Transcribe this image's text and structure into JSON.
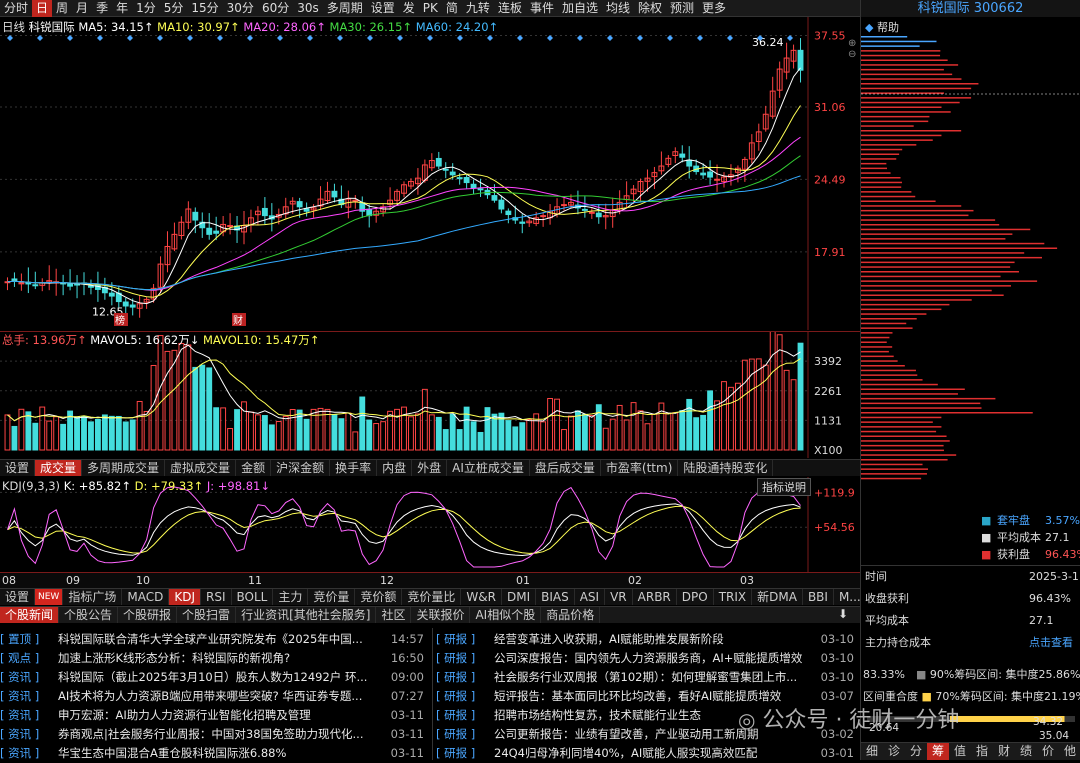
{
  "toolbar": {
    "items": [
      "分时",
      "日",
      "周",
      "月",
      "季",
      "年",
      "1分",
      "5分",
      "15分",
      "30分",
      "60分",
      "30s",
      "多周期",
      "设置",
      "发",
      "PK",
      "简",
      "九转",
      "连板",
      "事件",
      "加自选",
      "均线",
      "除权",
      "预测",
      "更多"
    ],
    "active": "日"
  },
  "kline": {
    "period_label": "日线",
    "stock_name": "科锐国际",
    "ma5": "MA5: 34.15↑",
    "ma10": "MA10: 30.97↑",
    "ma20": "MA20: 28.06↑",
    "ma30": "MA30: 26.15↑",
    "ma60": "MA60: 24.20↑",
    "price_axis": [
      "37.55",
      "31.06",
      "24.49",
      "17.91"
    ],
    "high_label": "36.24",
    "low_label": "12.65",
    "marks": [
      "榜",
      "财"
    ],
    "colors": {
      "ma5": "#ffffff",
      "ma10": "#ffff55",
      "ma20": "#ff44ff",
      "ma30": "#33cc33",
      "ma60": "#33aaff",
      "up": "#ff4444",
      "down": "#44dddd"
    }
  },
  "volume": {
    "total": "总手: 13.96万↑",
    "mavol5": "MAVOL5: 16.62万↓",
    "mavol10": "MAVOL10: 15.47万↑",
    "axis": [
      "3392",
      "2261",
      "1131",
      "X100"
    ]
  },
  "vol_tabs": [
    "设置",
    "成交量",
    "多周期成交量",
    "虚拟成交量",
    "金额",
    "沪深金额",
    "换手率",
    "内盘",
    "外盘",
    "AI立桩成交量",
    "盘后成交量",
    "市盈率(ttm)",
    "陆股通持股变化"
  ],
  "vol_tab_active": "成交量",
  "kdj": {
    "title": "KDJ(9,3,3)",
    "k": "K: +85.82↑",
    "d": "D: +79.33↑",
    "j": "J: +98.81↓",
    "axis": [
      "+119.9",
      "+54.56"
    ],
    "explain": "指标说明"
  },
  "months": [
    "08",
    "09",
    "10",
    "11",
    "12",
    "01",
    "02",
    "03"
  ],
  "indicator_tabs": [
    "设置",
    "NEW",
    "指标广场",
    "MACD",
    "KDJ",
    "RSI",
    "BOLL",
    "主力",
    "竞价量",
    "竞价额",
    "竞价量比",
    "W&R",
    "DMI",
    "BIAS",
    "ASI",
    "VR",
    "ARBR",
    "DPO",
    "TRIX",
    "新DMA",
    "BBI",
    "M..."
  ],
  "indicator_active": "KDJ",
  "news_tabs": [
    "个股新闻",
    "个股公告",
    "个股研报",
    "个股扫雷",
    "行业资讯[其他社会服务]",
    "社区",
    "关联报价",
    "AI相似个股",
    "商品价格"
  ],
  "news_left": [
    {
      "tag": "[ 置顶 ]",
      "title": "科锐国际联合清华大学全球产业研究院发布《2025年中国...",
      "time": "14:57"
    },
    {
      "tag": "[ 观点 ]",
      "title": "加速上涨形K线形态分析：科锐国际的新视角?",
      "time": "16:50"
    },
    {
      "tag": "[ 资讯 ]",
      "title": "科锐国际（截止2025年3月10日）股东人数为12492户 环...",
      "time": "09:00"
    },
    {
      "tag": "[ 资讯 ]",
      "title": "AI技术将为人力资源B端应用带来哪些突破? 华西证券专题...",
      "time": "07:27"
    },
    {
      "tag": "[ 资讯 ]",
      "title": "申万宏源：AI助力人力资源行业智能化招聘及管理",
      "time": "03-11"
    },
    {
      "tag": "[ 资讯 ]",
      "title": "券商观点|社会服务行业周报：中国对38国免签助力现代化...",
      "time": "03-11"
    },
    {
      "tag": "[ 资讯 ]",
      "title": "华宝生态中国混合A重仓股科锐国际涨6.88%",
      "time": "03-11"
    }
  ],
  "news_right": [
    {
      "tag": "[ 研报 ]",
      "title": "经营变革进入收获期，AI赋能助推发展新阶段",
      "time": "03-10"
    },
    {
      "tag": "[ 研报 ]",
      "title": "公司深度报告：国内领先人力资源服务商，AI+赋能提质增效",
      "time": "03-10"
    },
    {
      "tag": "[ 研报 ]",
      "title": "社会服务行业双周报（第102期）：如何理解蜜雪集团上市...",
      "time": "03-10"
    },
    {
      "tag": "[ 研报 ]",
      "title": "短评报告：基本面同比环比均改善，看好AI赋能提质增效",
      "time": "03-07"
    },
    {
      "tag": "[ 研报 ]",
      "title": "招聘市场结构性复苏，技术赋能行业生态",
      "time": ""
    },
    {
      "tag": "[ 研报 ]",
      "title": "公司更新报告：业绩有望改善，产业驱动用工新周期",
      "time": "03-02"
    },
    {
      "tag": "[ 研报 ]",
      "title": "24Q4归母净利同增40%，AI赋能人服实现高效匹配",
      "time": "03-01"
    }
  ],
  "right": {
    "title": "科锐国际 300662",
    "help": "帮助",
    "legend": [
      {
        "label": "套牢盘",
        "value": "3.57%"
      },
      {
        "label": "平均成本",
        "value": "27.1"
      },
      {
        "label": "获利盘",
        "value": "96.43%"
      }
    ],
    "rows": [
      {
        "k": "时间",
        "v": "2025-3-1"
      },
      {
        "k": "收盘获利",
        "v": "96.43%"
      },
      {
        "k": "平均成本",
        "v": "27.1"
      },
      {
        "k": "主力持仓成本",
        "v": "点击查看"
      }
    ],
    "conc1": {
      "a": "83.33%",
      "b": "90%筹码区间: 集中度25.86%"
    },
    "conc2": {
      "a": "区间重合度",
      "b": "70%筹码区间: 集中度21.19%"
    },
    "bottom_vals": [
      "20.64",
      "34.32",
      "35.04"
    ],
    "bottom_tabs": [
      "细",
      "诊",
      "分",
      "筹",
      "值",
      "指",
      "财",
      "绩",
      "价",
      "他"
    ],
    "bottom_active": "筹"
  },
  "watermark": "公众号 · 徒财一分钟",
  "chart_data": {
    "type": "candlestick",
    "note_series": [
      {
        "name": "close",
        "values": [
          15.2,
          15.3,
          15.1,
          15.0,
          14.9,
          15.1,
          15.3,
          15.2,
          15.0,
          14.8,
          14.9,
          15.0,
          14.7,
          14.5,
          14.2,
          13.9,
          13.4,
          13.0,
          12.9,
          13.2,
          13.6,
          14.6,
          16.8,
          18.4,
          19.5,
          20.6,
          21.8,
          20.8,
          20.1,
          19.5,
          19.6,
          20.4,
          20.3,
          19.9,
          20.3,
          21.0,
          21.6,
          21.2,
          20.9,
          21.3,
          22.0,
          22.5,
          22.0,
          21.6,
          21.9,
          22.7,
          23.4,
          22.9,
          22.2,
          22.7,
          22.6,
          21.6,
          21.2,
          21.6,
          22.0,
          22.6,
          23.4,
          24.0,
          24.3,
          24.6,
          25.8,
          26.2,
          25.7,
          25.4,
          24.9,
          24.6,
          24.2,
          23.7,
          23.6,
          23.1,
          22.6,
          21.8,
          21.3,
          20.8,
          20.5,
          20.7,
          21.0,
          21.2,
          21.6,
          22.0,
          22.2,
          22.4,
          21.9,
          21.7,
          21.5,
          21.1,
          21.2,
          21.7,
          22.4,
          23.0,
          23.6,
          24.3,
          24.6,
          25.1,
          25.7,
          26.4,
          27.0,
          26.5,
          25.7,
          25.2,
          24.9,
          24.7,
          24.5,
          24.7,
          24.9,
          25.5,
          26.3,
          27.8,
          28.8,
          30.4,
          32.5,
          34.5,
          35.5,
          36.2,
          34.4
        ]
      }
    ]
  }
}
